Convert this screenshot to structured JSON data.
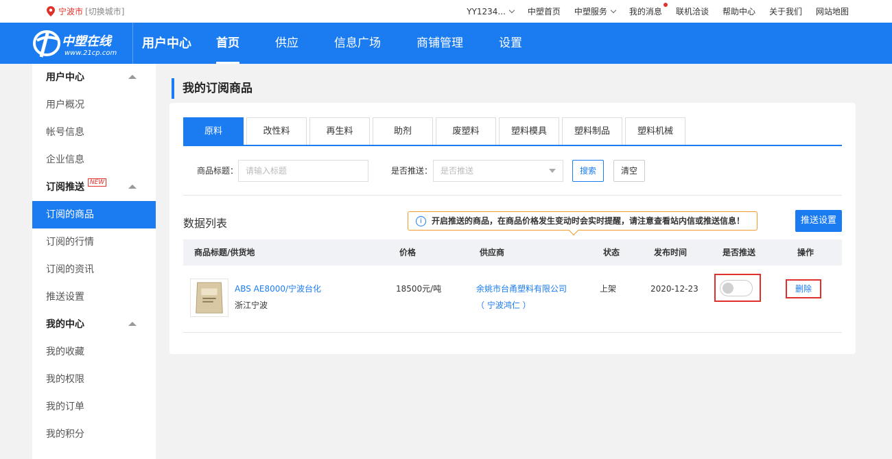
{
  "topbar": {
    "city": "宁波市",
    "switch_city": "[切换城市]",
    "links": [
      {
        "label": "YY1234...",
        "dropdown": true
      },
      {
        "label": "中塑首页"
      },
      {
        "label": "中塑服务",
        "dropdown": true
      },
      {
        "label": "我的消息",
        "badge": true
      },
      {
        "label": "联机洽谈"
      },
      {
        "label": "帮助中心"
      },
      {
        "label": "关于我们"
      },
      {
        "label": "网站地图"
      }
    ]
  },
  "nav": {
    "logo_text": "中塑在线",
    "logo_url_text": "www.21cp.com",
    "center_title": "用户中心",
    "menu": [
      "首页",
      "供应",
      "信息广场",
      "商铺管理",
      "设置"
    ],
    "active_index": 0
  },
  "sidebar": {
    "items": [
      {
        "type": "group",
        "label": "用户中心"
      },
      {
        "type": "sub",
        "label": "用户概况"
      },
      {
        "type": "sub",
        "label": "帐号信息"
      },
      {
        "type": "sub",
        "label": "企业信息"
      },
      {
        "type": "group",
        "label": "订阅推送",
        "badge": "NEW"
      },
      {
        "type": "sub",
        "label": "订阅的商品",
        "active": true
      },
      {
        "type": "sub",
        "label": "订阅的行情"
      },
      {
        "type": "sub",
        "label": "订阅的资讯"
      },
      {
        "type": "sub",
        "label": "推送设置"
      },
      {
        "type": "group",
        "label": "我的中心"
      },
      {
        "type": "sub",
        "label": "我的收藏"
      },
      {
        "type": "sub",
        "label": "我的权限"
      },
      {
        "type": "sub",
        "label": "我的订单"
      },
      {
        "type": "sub",
        "label": "我的积分"
      }
    ]
  },
  "page_title": "我的订阅商品",
  "tabs": [
    "原料",
    "改性料",
    "再生料",
    "助剂",
    "废塑料",
    "塑料模具",
    "塑料制品",
    "塑料机械"
  ],
  "filter": {
    "title_label": "商品标题：",
    "title_placeholder": "请输入标题",
    "push_label": "是否推送：",
    "push_placeholder": "是否推送",
    "search_label": "搜索",
    "clear_label": "清空"
  },
  "list": {
    "title": "数据列表",
    "notice": "开启推送的商品，在商品价格发生变动时会实时提醒，请注意查看站内信或推送信息！",
    "push_settings_label": "推送设置",
    "columns": [
      "商品标题/供货地",
      "价格",
      "供应商",
      "状态",
      "发布时间",
      "是否推送",
      "操作"
    ],
    "rows": [
      {
        "title": "ABS AE8000/宁波台化",
        "location": "浙江宁波",
        "price": "18500元/吨",
        "supplier": "余姚市台甬塑料有限公司",
        "supplier_sub": "（ 宁波鸿仁 ）",
        "status": "上架",
        "date": "2020-12-23",
        "push_enabled": false,
        "action": "删除"
      }
    ]
  },
  "colors": {
    "primary": "#1b7cf2",
    "highlight": "#e0302b",
    "notice_border": "#f39a2b"
  }
}
